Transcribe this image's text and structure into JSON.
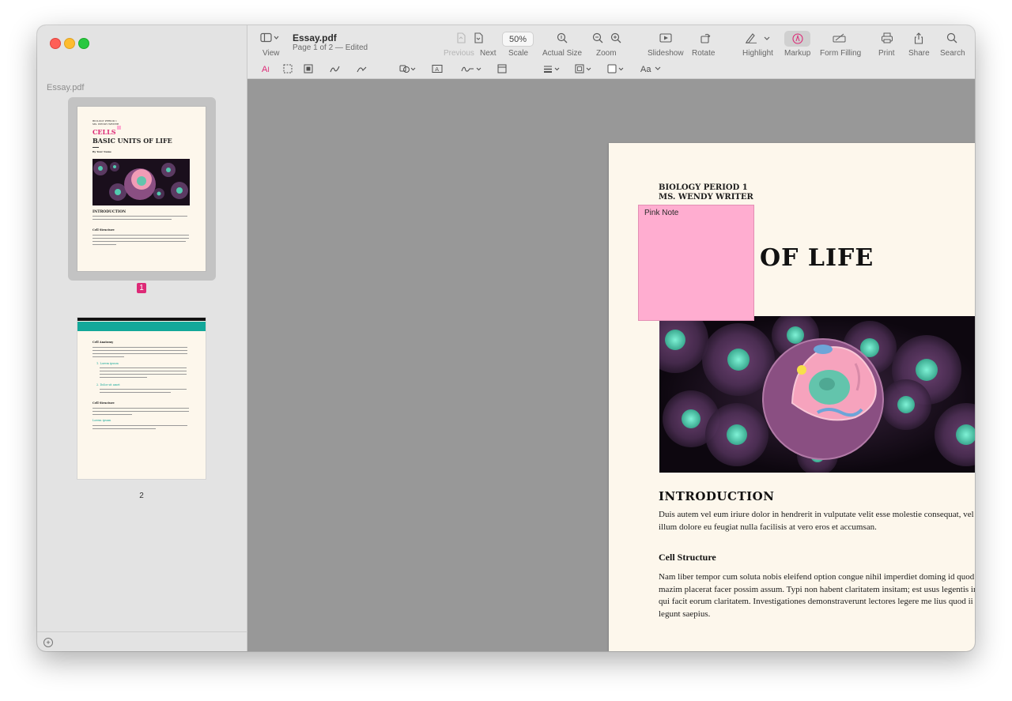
{
  "app": {
    "document_title": "Essay.pdf",
    "subtitle": "Page 1 of 2 — Edited",
    "sidebar_title": "Essay.pdf"
  },
  "toolbar": {
    "view": "View",
    "previous": "Previous",
    "next": "Next",
    "scale_value": "50%",
    "scale": "Scale",
    "actual_size": "Actual Size",
    "zoom": "Zoom",
    "slideshow": "Slideshow",
    "rotate": "Rotate",
    "highlight": "Highlight",
    "markup": "Markup",
    "form_filling": "Form Filling",
    "print": "Print",
    "share": "Share",
    "search": "Search",
    "text_style": "Aa"
  },
  "sidebar": {
    "pages": [
      {
        "number": "1",
        "selected": true
      },
      {
        "number": "2",
        "selected": false
      }
    ]
  },
  "document": {
    "course": "BIOLOGY PERIOD 1",
    "teacher": "MS. WENDY WRITER",
    "title_visible": "UNITS OF LIFE",
    "intro_heading": "INTRODUCTION",
    "intro_text": "Duis autem vel eum iriure dolor in hendrerit in vulputate velit esse molestie consequat, vel illum dolore eu feugiat nulla facilisis at vero eros et accumsan.",
    "cell_heading": "Cell Structure",
    "cell_text": "Nam liber tempor cum soluta nobis eleifend option congue nihil imperdiet doming id quod mazim placerat facer possim assum. Typi non habent claritatem insitam; est usus legentis in iis qui facit eorum claritatem. Investigationes demonstraverunt lectores legere me lius quod ii legunt saepius."
  },
  "note": {
    "label": "Pink Note",
    "color": "#ffadd0"
  },
  "thumbnails": {
    "p1_cells": "CELLS",
    "p1_title": "BASIC UNITS OF LIFE",
    "p1_intro": "INTRODUCTION",
    "p1_structure": "Cell Structure",
    "p2_anatomy": "Cell Anatomy",
    "p2_item1": "1. Lorem ipsum",
    "p2_item2": "2. Dolor sit amet",
    "p2_structure": "Cell Structure",
    "p2_lorem": "Lorem ipsum"
  },
  "colors": {
    "accent_pink": "#dd2a77",
    "teal": "#13a89a"
  },
  "icons": [
    "sidebar-view-icon",
    "previous-page-icon",
    "next-page-icon",
    "actual-size-icon",
    "zoom-out-icon",
    "zoom-in-icon",
    "slideshow-icon",
    "rotate-icon",
    "highlight-pen-icon",
    "markup-icon",
    "form-filling-icon",
    "print-icon",
    "share-icon",
    "search-icon"
  ]
}
